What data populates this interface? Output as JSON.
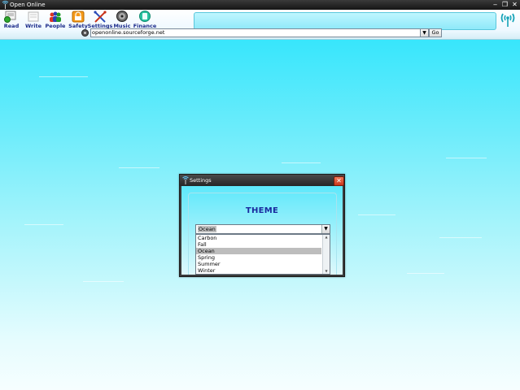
{
  "window": {
    "title": "Open Online",
    "controls": [
      "minimize",
      "restore",
      "close"
    ]
  },
  "toolbar": {
    "buttons": [
      {
        "label": "Read",
        "icon": "read-icon"
      },
      {
        "label": "Write",
        "icon": "write-icon"
      },
      {
        "label": "People",
        "icon": "people-icon"
      },
      {
        "label": "Safety",
        "icon": "safety-icon"
      },
      {
        "label": "Settings",
        "icon": "settings-icon"
      },
      {
        "label": "Music",
        "icon": "music-icon"
      },
      {
        "label": "Finance",
        "icon": "finance-icon"
      }
    ],
    "address": "openonline.sourceforge.net",
    "go_label": "Go"
  },
  "dialog": {
    "title": "Settings",
    "heading": "THEME",
    "selected_theme": "Ocean",
    "options": [
      "Carbon",
      "Fall",
      "Ocean",
      "Spring",
      "Summer",
      "Winter"
    ],
    "selected_index": 2
  },
  "colors": {
    "accent": "#1a2a9e",
    "background_top": "#2fe3fb",
    "background_bottom": "#f6feff",
    "close_red": "#d8451f"
  }
}
